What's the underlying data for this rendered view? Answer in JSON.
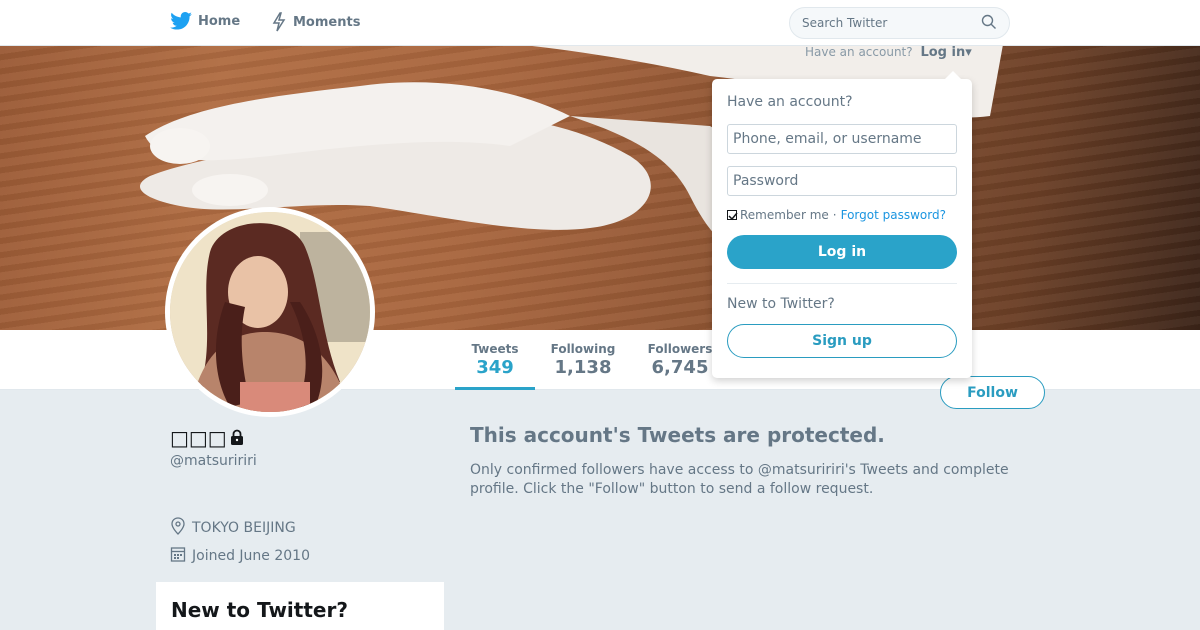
{
  "nav": {
    "home_label": "Home",
    "moments_label": "Moments",
    "search_placeholder": "Search Twitter"
  },
  "login_menu": {
    "prompt": "Have an account?",
    "link_label": "Log in",
    "dropdown_title": "Have an account?",
    "username_placeholder": "Phone, email, or username",
    "password_placeholder": "Password",
    "remember_label": "Remember me",
    "separator": "·",
    "forgot_label": "Forgot password?",
    "login_button": "Log in",
    "new_to_twitter": "New to Twitter?",
    "signup_button": "Sign up"
  },
  "profile": {
    "display_name": "",
    "handle": "@matsuririri",
    "location": "TOKYO BEIJING",
    "joined": "Joined June 2010",
    "stats": [
      {
        "label": "Tweets",
        "value": "349"
      },
      {
        "label": "Following",
        "value": "1,138"
      },
      {
        "label": "Followers",
        "value": "6,745"
      }
    ],
    "follow_button": "Follow"
  },
  "sidebar_card": {
    "title": "New to Twitter?"
  },
  "protected": {
    "title": "This account's Tweets are protected.",
    "body": "Only confirmed followers have access to @matsuririri's Tweets and complete profile. Click the \"Follow\" button to send a follow request."
  },
  "colors": {
    "accent": "#2aa3c9",
    "text_muted": "#657786",
    "background": "#e6ecf0"
  },
  "icons": [
    "twitter-bird-icon",
    "lightning-icon",
    "search-icon",
    "lock-icon",
    "location-pin-icon",
    "calendar-icon",
    "caret-down-icon"
  ]
}
